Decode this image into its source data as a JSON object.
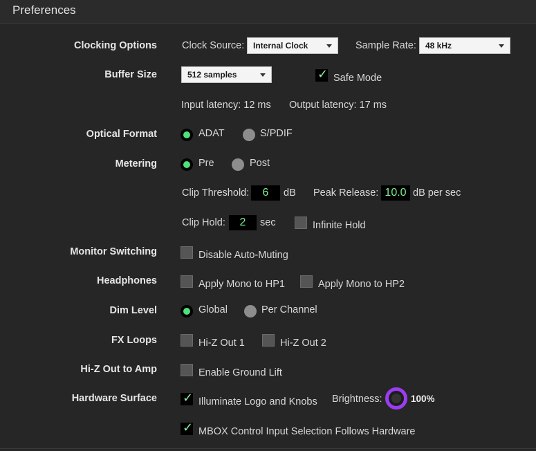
{
  "window": {
    "title": "Preferences"
  },
  "clocking": {
    "label": "Clocking Options",
    "clock_source_label": "Clock Source:",
    "clock_source_value": "Internal Clock",
    "sample_rate_label": "Sample Rate:",
    "sample_rate_value": "48 kHz"
  },
  "buffer": {
    "label": "Buffer Size",
    "value": "512 samples",
    "safe_mode_label": "Safe Mode",
    "safe_mode_checked": true,
    "input_latency": "Input latency: 12 ms",
    "output_latency": "Output latency: 17 ms"
  },
  "optical": {
    "label": "Optical Format",
    "options": [
      "ADAT",
      "S/PDIF"
    ],
    "selected": "ADAT"
  },
  "metering": {
    "label": "Metering",
    "options": [
      "Pre",
      "Post"
    ],
    "selected": "Pre",
    "clip_threshold_label": "Clip Threshold:",
    "clip_threshold_value": "6",
    "clip_threshold_unit": "dB",
    "peak_release_label": "Peak Release:",
    "peak_release_value": "10.0",
    "peak_release_unit": "dB per sec",
    "clip_hold_label": "Clip Hold:",
    "clip_hold_value": "2",
    "clip_hold_unit": "sec",
    "infinite_hold_label": "Infinite Hold"
  },
  "monitor": {
    "label": "Monitor Switching",
    "disable_auto_muting_label": "Disable Auto-Muting"
  },
  "headphones": {
    "label": "Headphones",
    "mono_hp1_label": "Apply Mono to HP1",
    "mono_hp2_label": "Apply Mono to HP2"
  },
  "dim": {
    "label": "Dim Level",
    "options": [
      "Global",
      "Per Channel"
    ],
    "selected": "Global"
  },
  "fx": {
    "label": "FX Loops",
    "out1_label": "Hi-Z Out 1",
    "out2_label": "Hi-Z Out 2"
  },
  "hiz": {
    "label": "Hi-Z Out to Amp",
    "ground_lift_label": "Enable Ground Lift"
  },
  "hardware": {
    "label": "Hardware Surface",
    "illuminate_label": "Illuminate Logo and Knobs",
    "brightness_label": "Brightness:",
    "brightness_value": "100%",
    "mbox_label": "MBOX Control Input Selection Follows Hardware"
  },
  "icons": {
    "check": "✓",
    "accent": "#9a3df0",
    "led_green": "#4fe07a"
  }
}
